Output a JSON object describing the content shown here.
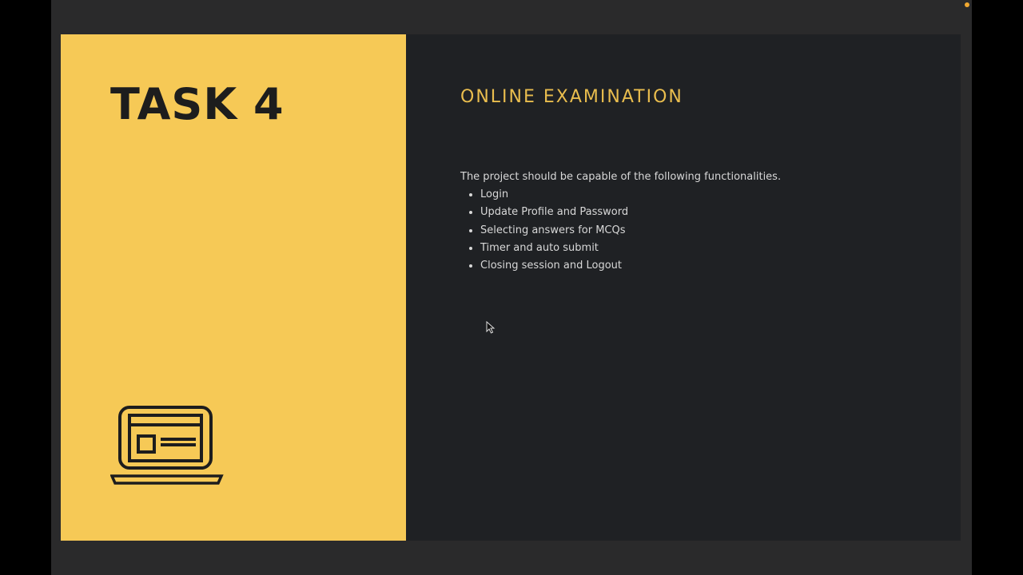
{
  "slide": {
    "title": "TASK 4",
    "heading": "ONLINE EXAMINATION",
    "intro": "The project should be capable of the following functionalities.",
    "bullets": [
      "Login",
      "Update Profile and Password",
      "Selecting answers for MCQs",
      "Timer and auto submit",
      "Closing session and Logout"
    ]
  },
  "colors": {
    "accent_yellow": "#f6c956",
    "panel_dark": "#1f2124",
    "heading": "#e9bd4e"
  }
}
